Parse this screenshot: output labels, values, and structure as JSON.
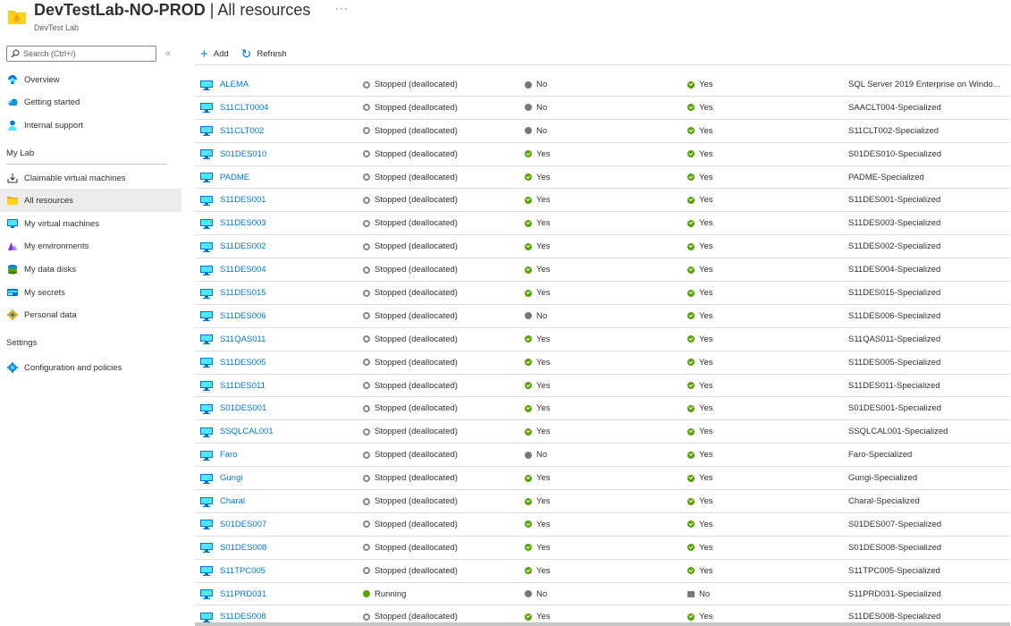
{
  "header": {
    "title": "DevTestLab-NO-PROD",
    "title_suffix": " | All resources",
    "more": "···",
    "subtitle": "DevTest Lab"
  },
  "sidebar": {
    "search_placeholder": "Search (Ctrl+/)",
    "collapse_glyph": "«",
    "top_items": [
      {
        "label": "Overview",
        "icon": "overview-icon"
      },
      {
        "label": "Getting started",
        "icon": "cloud-icon"
      },
      {
        "label": "Internal support",
        "icon": "person-icon"
      }
    ],
    "sections": [
      {
        "title": "My Lab",
        "items": [
          {
            "label": "Claimable virtual machines",
            "icon": "download-icon"
          },
          {
            "label": "All resources",
            "icon": "folder-icon",
            "selected": true
          },
          {
            "label": "My virtual machines",
            "icon": "vm-icon"
          },
          {
            "label": "My environments",
            "icon": "environment-icon"
          },
          {
            "label": "My data disks",
            "icon": "disk-icon"
          },
          {
            "label": "My secrets",
            "icon": "secret-icon"
          },
          {
            "label": "Personal data",
            "icon": "gear-icon"
          }
        ]
      },
      {
        "title": "Settings",
        "items": [
          {
            "label": "Configuration and policies",
            "icon": "settings-icon"
          }
        ]
      }
    ]
  },
  "toolbar": {
    "add_label": "Add",
    "refresh_label": "Refresh"
  },
  "colors": {
    "accent": "#0078d4",
    "success": "#57a300",
    "neutral": "#797775",
    "selected_bg": "#edebe9"
  },
  "table": {
    "rows": [
      {
        "name": "ALEMA",
        "status": "Stopped (deallocated)",
        "claimable": "No",
        "autostart": "Yes",
        "image": "SQL Server 2019 Enterprise on Windo..."
      },
      {
        "name": "S11CLT0004",
        "status": "Stopped (deallocated)",
        "claimable": "No",
        "autostart": "Yes",
        "image": "SAACLT004-Specialized"
      },
      {
        "name": "S11CLT002",
        "status": "Stopped (deallocated)",
        "claimable": "No",
        "autostart": "Yes",
        "image": "S11CLT002-Specialized"
      },
      {
        "name": "S01DES010",
        "status": "Stopped (deallocated)",
        "claimable": "Yes",
        "autostart": "Yes",
        "image": "S01DES010-Specialized"
      },
      {
        "name": "PADME",
        "status": "Stopped (deallocated)",
        "claimable": "Yes",
        "autostart": "Yes",
        "image": "PADME-Specialized"
      },
      {
        "name": "S11DES001",
        "status": "Stopped (deallocated)",
        "claimable": "Yes",
        "autostart": "Yes",
        "image": "S11DES001-Specialized"
      },
      {
        "name": "S11DES003",
        "status": "Stopped (deallocated)",
        "claimable": "Yes",
        "autostart": "Yes",
        "image": "S11DES003-Specialized"
      },
      {
        "name": "S11DES002",
        "status": "Stopped (deallocated)",
        "claimable": "Yes",
        "autostart": "Yes",
        "image": "S11DES002-Specialized"
      },
      {
        "name": "S11DES004",
        "status": "Stopped (deallocated)",
        "claimable": "Yes",
        "autostart": "Yes",
        "image": "S11DES004-Specialized"
      },
      {
        "name": "S11DES015",
        "status": "Stopped (deallocated)",
        "claimable": "Yes",
        "autostart": "Yes",
        "image": "S11DES015-Specialized"
      },
      {
        "name": "S11DES006",
        "status": "Stopped (deallocated)",
        "claimable": "No",
        "autostart": "Yes",
        "image": "S11DES006-Specialized"
      },
      {
        "name": "S11QAS011",
        "status": "Stopped (deallocated)",
        "claimable": "Yes",
        "autostart": "Yes",
        "image": "S11QAS011-Specialized"
      },
      {
        "name": "S11DES005",
        "status": "Stopped (deallocated)",
        "claimable": "Yes",
        "autostart": "Yes",
        "image": "S11DES005-Specialized"
      },
      {
        "name": "S11DES011",
        "status": "Stopped (deallocated)",
        "claimable": "Yes",
        "autostart": "Yes",
        "image": "S11DES011-Specialized"
      },
      {
        "name": "S01DES001",
        "status": "Stopped (deallocated)",
        "claimable": "Yes",
        "autostart": "Yes",
        "image": "S01DES001-Specialized"
      },
      {
        "name": "SSQLCAL001",
        "status": "Stopped (deallocated)",
        "claimable": "Yes",
        "autostart": "Yes",
        "image": "SSQLCAL001-Specialized"
      },
      {
        "name": "Faro",
        "status": "Stopped (deallocated)",
        "claimable": "No",
        "autostart": "Yes",
        "image": "Faro-Specialized"
      },
      {
        "name": "Gungi",
        "status": "Stopped (deallocated)",
        "claimable": "Yes",
        "autostart": "Yes",
        "image": "Gungi-Specialized"
      },
      {
        "name": "Charal",
        "status": "Stopped (deallocated)",
        "claimable": "Yes",
        "autostart": "Yes",
        "image": "Charal-Specialized"
      },
      {
        "name": "S01DES007",
        "status": "Stopped (deallocated)",
        "claimable": "Yes",
        "autostart": "Yes",
        "image": "S01DES007-Specialized"
      },
      {
        "name": "S01DES008",
        "status": "Stopped (deallocated)",
        "claimable": "Yes",
        "autostart": "Yes",
        "image": "S01DES008-Specialized"
      },
      {
        "name": "S11TPC005",
        "status": "Stopped (deallocated)",
        "claimable": "Yes",
        "autostart": "Yes",
        "image": "S11TPC005-Specialized"
      },
      {
        "name": "S11PRD031",
        "status": "Running",
        "claimable": "No",
        "autostart": "No",
        "image": "S11PRD031-Specialized"
      },
      {
        "name": "S11DES008",
        "status": "Stopped (deallocated)",
        "claimable": "Yes",
        "autostart": "Yes",
        "image": "S11DES008-Specialized"
      }
    ]
  }
}
